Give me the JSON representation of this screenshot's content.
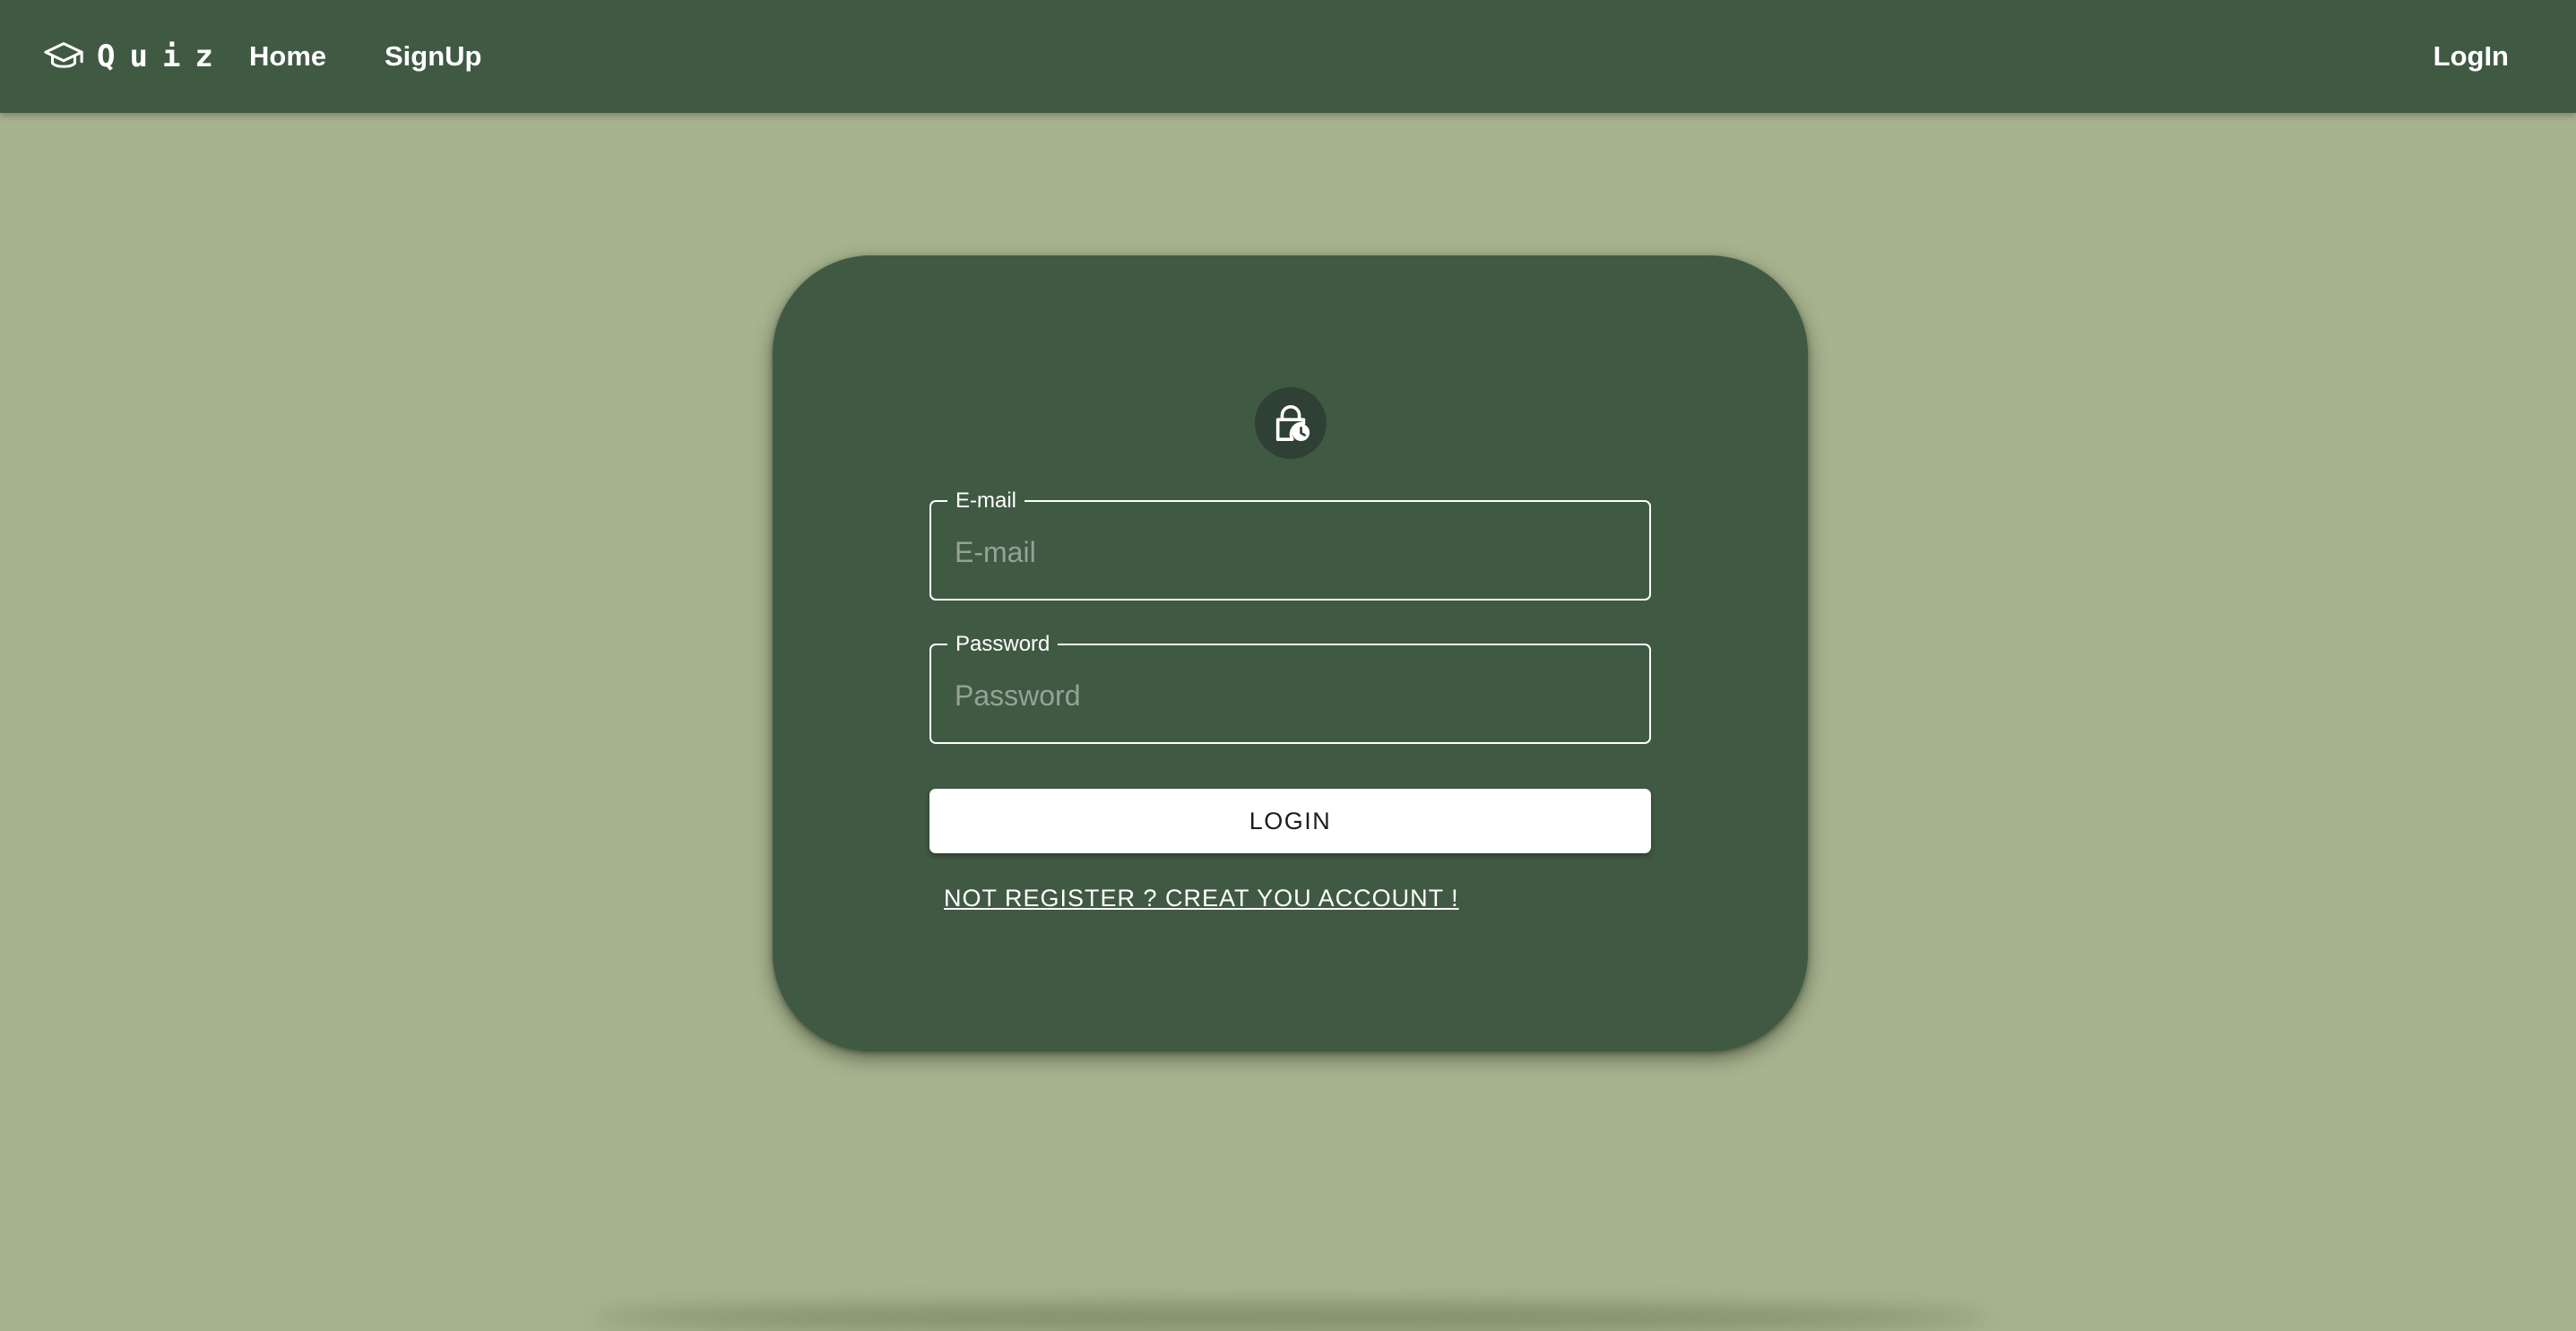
{
  "navbar": {
    "brand_icon": "graduation-cap-icon",
    "brand_text": "Quiz",
    "links": [
      {
        "label": "Home"
      },
      {
        "label": "SignUp"
      }
    ],
    "login_label": "LogIn",
    "background": "#405943"
  },
  "login_form": {
    "icon": "lock-clock-icon",
    "email": {
      "label": "E-mail",
      "placeholder": "E-mail",
      "value": ""
    },
    "password": {
      "label": "Password",
      "placeholder": "Password",
      "value": ""
    },
    "submit_label": "LOGIN",
    "register_link": "NOT REGISTER ? CREAT YOU ACCOUNT !"
  },
  "colors": {
    "page_background": "#a6b38f",
    "card_background": "#405943",
    "button_background": "#ffffff"
  }
}
